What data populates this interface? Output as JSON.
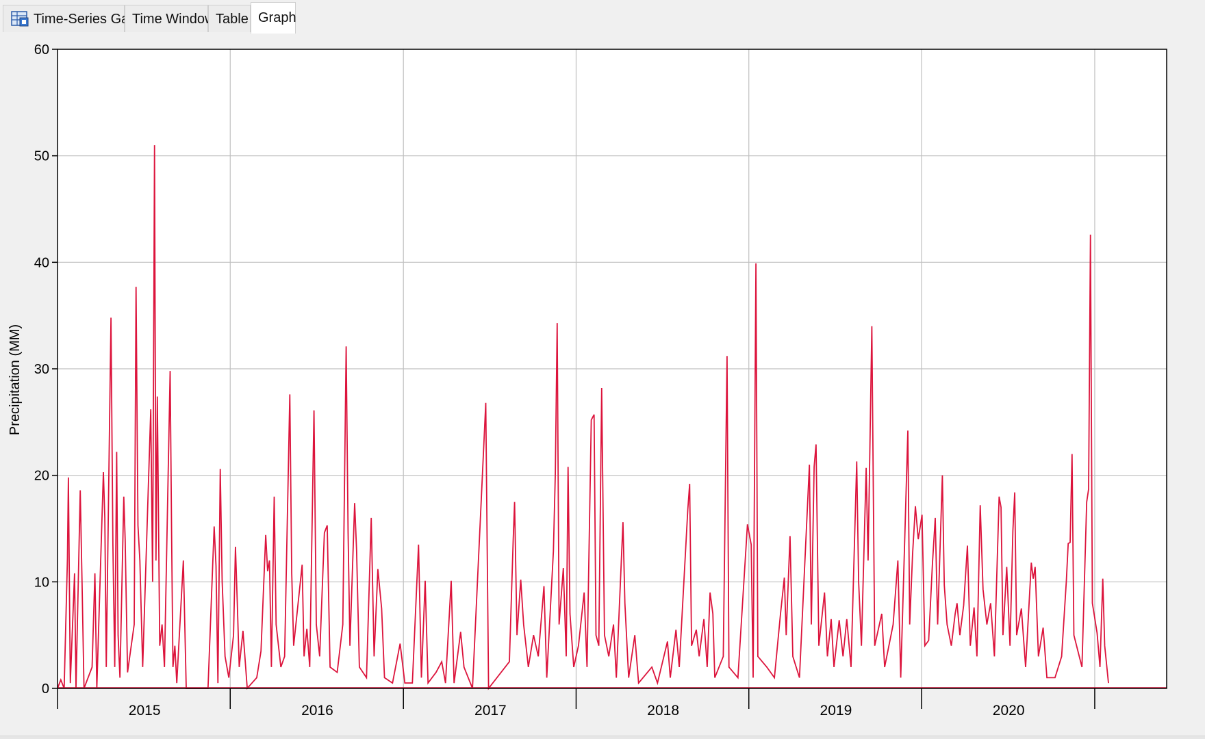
{
  "tabs": [
    {
      "label": "Time-Series Gage",
      "icon": "gage-table-icon",
      "active": false
    },
    {
      "label": "Time Window",
      "active": false
    },
    {
      "label": "Table",
      "active": false
    },
    {
      "label": "Graph",
      "active": true
    }
  ],
  "colors": {
    "series": "#dc143c",
    "grid": "#c0c0c0",
    "plot_bg": "#ffffff",
    "axis": "#000000"
  },
  "chart_data": {
    "type": "line",
    "ylabel": "Precipitation (MM)",
    "xlabel": "",
    "ylim": [
      0,
      60
    ],
    "yticks": [
      0,
      10,
      20,
      30,
      40,
      50,
      60
    ],
    "xlim": [
      "2014-07-01",
      "2020-11-30"
    ],
    "xticks": [
      "2014-07-01",
      "2015-07-01",
      "2016-07-01",
      "2017-07-01",
      "2018-07-01",
      "2019-07-01",
      "2020-07-01"
    ],
    "xtick_labels": [
      {
        "label": "2015",
        "at": "2015-01-01"
      },
      {
        "label": "2016",
        "at": "2016-01-01"
      },
      {
        "label": "2017",
        "at": "2017-01-01"
      },
      {
        "label": "2018",
        "at": "2018-01-01"
      },
      {
        "label": "2019",
        "at": "2019-01-01"
      },
      {
        "label": "2020",
        "at": "2020-01-01"
      }
    ],
    "grid": true,
    "series": [
      {
        "points": [
          [
            "2014-07-01",
            0
          ],
          [
            "2014-07-08",
            0.8
          ],
          [
            "2014-07-15",
            0
          ],
          [
            "2014-07-22",
            12.2
          ],
          [
            "2014-07-24",
            19.8
          ],
          [
            "2014-07-28",
            0.5
          ],
          [
            "2014-08-06",
            10.8
          ],
          [
            "2014-08-09",
            0
          ],
          [
            "2014-08-18",
            18.6
          ],
          [
            "2014-08-22",
            9.7
          ],
          [
            "2014-08-26",
            0
          ],
          [
            "2014-09-12",
            2
          ],
          [
            "2014-09-18",
            10.8
          ],
          [
            "2014-09-22",
            0
          ],
          [
            "2014-10-06",
            20.3
          ],
          [
            "2014-10-09",
            16
          ],
          [
            "2014-10-12",
            2
          ],
          [
            "2014-10-22",
            34.8
          ],
          [
            "2014-10-26",
            13.5
          ],
          [
            "2014-10-30",
            2
          ],
          [
            "2014-11-03",
            22.2
          ],
          [
            "2014-11-06",
            5
          ],
          [
            "2014-11-10",
            1
          ],
          [
            "2014-11-18",
            18
          ],
          [
            "2014-11-21",
            14
          ],
          [
            "2014-11-26",
            1.5
          ],
          [
            "2014-12-10",
            6
          ],
          [
            "2014-12-14",
            37.7
          ],
          [
            "2014-12-18",
            15.3
          ],
          [
            "2014-12-22",
            12
          ],
          [
            "2014-12-28",
            2
          ],
          [
            "2015-01-14",
            26.2
          ],
          [
            "2015-01-18",
            10
          ],
          [
            "2015-01-22",
            51
          ],
          [
            "2015-01-25",
            12
          ],
          [
            "2015-01-28",
            27.4
          ],
          [
            "2015-02-02",
            4
          ],
          [
            "2015-02-07",
            6
          ],
          [
            "2015-02-12",
            2
          ],
          [
            "2015-02-24",
            29.8
          ],
          [
            "2015-02-27",
            14.8
          ],
          [
            "2015-03-02",
            2
          ],
          [
            "2015-03-06",
            4
          ],
          [
            "2015-03-10",
            0.5
          ],
          [
            "2015-03-24",
            12
          ],
          [
            "2015-03-30",
            0
          ],
          [
            "2015-05-15",
            0
          ],
          [
            "2015-05-28",
            15.2
          ],
          [
            "2015-06-01",
            11.5
          ],
          [
            "2015-06-05",
            0.5
          ],
          [
            "2015-06-10",
            20.6
          ],
          [
            "2015-06-14",
            10
          ],
          [
            "2015-06-20",
            3
          ],
          [
            "2015-06-28",
            1
          ],
          [
            "2015-07-08",
            5
          ],
          [
            "2015-07-12",
            13.3
          ],
          [
            "2015-07-16",
            8
          ],
          [
            "2015-07-20",
            2
          ],
          [
            "2015-07-28",
            5.4
          ],
          [
            "2015-08-06",
            0
          ],
          [
            "2015-08-26",
            1
          ],
          [
            "2015-09-04",
            3.5
          ],
          [
            "2015-09-14",
            14.4
          ],
          [
            "2015-09-18",
            11
          ],
          [
            "2015-09-22",
            12
          ],
          [
            "2015-09-26",
            2
          ],
          [
            "2015-10-02",
            18
          ],
          [
            "2015-10-06",
            6
          ],
          [
            "2015-10-16",
            2
          ],
          [
            "2015-10-24",
            3
          ],
          [
            "2015-11-04",
            27.6
          ],
          [
            "2015-11-08",
            10.8
          ],
          [
            "2015-11-12",
            4
          ],
          [
            "2015-11-30",
            11.6
          ],
          [
            "2015-12-04",
            3
          ],
          [
            "2015-12-10",
            5.6
          ],
          [
            "2015-12-16",
            2
          ],
          [
            "2015-12-25",
            26.1
          ],
          [
            "2015-12-30",
            6
          ],
          [
            "2016-01-06",
            3
          ],
          [
            "2016-01-16",
            14.6
          ],
          [
            "2016-01-22",
            15.3
          ],
          [
            "2016-01-28",
            2
          ],
          [
            "2016-02-12",
            1.5
          ],
          [
            "2016-02-24",
            6
          ],
          [
            "2016-03-02",
            32.1
          ],
          [
            "2016-03-06",
            14.7
          ],
          [
            "2016-03-10",
            4
          ],
          [
            "2016-03-20",
            17.4
          ],
          [
            "2016-03-24",
            13
          ],
          [
            "2016-03-30",
            2
          ],
          [
            "2016-04-14",
            1
          ],
          [
            "2016-04-24",
            16
          ],
          [
            "2016-04-30",
            3
          ],
          [
            "2016-05-08",
            11.2
          ],
          [
            "2016-05-16",
            7.5
          ],
          [
            "2016-05-22",
            1
          ],
          [
            "2016-06-08",
            0.5
          ],
          [
            "2016-06-24",
            4.2
          ],
          [
            "2016-07-04",
            0.5
          ],
          [
            "2016-07-20",
            0.5
          ],
          [
            "2016-08-02",
            13.5
          ],
          [
            "2016-08-08",
            1
          ],
          [
            "2016-08-16",
            10.1
          ],
          [
            "2016-08-22",
            0.5
          ],
          [
            "2016-09-08",
            1.5
          ],
          [
            "2016-09-20",
            2.5
          ],
          [
            "2016-09-28",
            0.5
          ],
          [
            "2016-10-10",
            10.1
          ],
          [
            "2016-10-16",
            0.5
          ],
          [
            "2016-10-30",
            5.3
          ],
          [
            "2016-11-06",
            2
          ],
          [
            "2016-11-24",
            0
          ],
          [
            "2016-12-22",
            26.8
          ],
          [
            "2016-12-28",
            0
          ],
          [
            "2017-02-10",
            2.5
          ],
          [
            "2017-02-18",
            14
          ],
          [
            "2017-02-21",
            17.5
          ],
          [
            "2017-02-26",
            5
          ],
          [
            "2017-03-06",
            10.2
          ],
          [
            "2017-03-12",
            6
          ],
          [
            "2017-03-22",
            2
          ],
          [
            "2017-04-02",
            5
          ],
          [
            "2017-04-12",
            3
          ],
          [
            "2017-04-24",
            9.6
          ],
          [
            "2017-04-30",
            1
          ],
          [
            "2017-05-14",
            12.9
          ],
          [
            "2017-05-18",
            20.2
          ],
          [
            "2017-05-22",
            34.3
          ],
          [
            "2017-05-26",
            6
          ],
          [
            "2017-06-04",
            11.3
          ],
          [
            "2017-06-10",
            3
          ],
          [
            "2017-06-14",
            20.8
          ],
          [
            "2017-06-18",
            7
          ],
          [
            "2017-06-26",
            2
          ],
          [
            "2017-07-06",
            4
          ],
          [
            "2017-07-18",
            9
          ],
          [
            "2017-07-24",
            2
          ],
          [
            "2017-08-02",
            25.2
          ],
          [
            "2017-08-08",
            25.7
          ],
          [
            "2017-08-12",
            5
          ],
          [
            "2017-08-18",
            4
          ],
          [
            "2017-08-24",
            28.2
          ],
          [
            "2017-08-30",
            5
          ],
          [
            "2017-09-08",
            3
          ],
          [
            "2017-09-18",
            6
          ],
          [
            "2017-09-24",
            1
          ],
          [
            "2017-10-08",
            15.6
          ],
          [
            "2017-10-12",
            8
          ],
          [
            "2017-10-20",
            1
          ],
          [
            "2017-11-02",
            5
          ],
          [
            "2017-11-10",
            0.5
          ],
          [
            "2017-12-08",
            2
          ],
          [
            "2017-12-20",
            0.5
          ],
          [
            "2018-01-10",
            4.4
          ],
          [
            "2018-01-16",
            1
          ],
          [
            "2018-01-28",
            5.5
          ],
          [
            "2018-02-04",
            2
          ],
          [
            "2018-02-22",
            16.8
          ],
          [
            "2018-02-26",
            19.2
          ],
          [
            "2018-03-02",
            4
          ],
          [
            "2018-03-12",
            5.5
          ],
          [
            "2018-03-18",
            3
          ],
          [
            "2018-03-28",
            6.5
          ],
          [
            "2018-04-04",
            2
          ],
          [
            "2018-04-10",
            9
          ],
          [
            "2018-04-16",
            7
          ],
          [
            "2018-04-20",
            1
          ],
          [
            "2018-05-08",
            3
          ],
          [
            "2018-05-16",
            31.2
          ],
          [
            "2018-05-20",
            2
          ],
          [
            "2018-06-08",
            1
          ],
          [
            "2018-06-28",
            15.4
          ],
          [
            "2018-07-06",
            13.5
          ],
          [
            "2018-07-10",
            1
          ],
          [
            "2018-07-16",
            39.9
          ],
          [
            "2018-07-20",
            3
          ],
          [
            "2018-08-08",
            2
          ],
          [
            "2018-08-24",
            1
          ],
          [
            "2018-09-06",
            7
          ],
          [
            "2018-09-14",
            10.4
          ],
          [
            "2018-09-18",
            5
          ],
          [
            "2018-09-26",
            14.3
          ],
          [
            "2018-10-02",
            3
          ],
          [
            "2018-10-16",
            1
          ],
          [
            "2018-11-06",
            21
          ],
          [
            "2018-11-10",
            6
          ],
          [
            "2018-11-16",
            20.8
          ],
          [
            "2018-11-20",
            22.9
          ],
          [
            "2018-11-26",
            4
          ],
          [
            "2018-12-08",
            9
          ],
          [
            "2018-12-14",
            3
          ],
          [
            "2018-12-22",
            6.5
          ],
          [
            "2018-12-28",
            2
          ],
          [
            "2019-01-08",
            6.4
          ],
          [
            "2019-01-16",
            3
          ],
          [
            "2019-01-24",
            6.5
          ],
          [
            "2019-02-02",
            2
          ],
          [
            "2019-02-14",
            21.3
          ],
          [
            "2019-02-18",
            10
          ],
          [
            "2019-02-24",
            4
          ],
          [
            "2019-03-06",
            20.7
          ],
          [
            "2019-03-10",
            12
          ],
          [
            "2019-03-18",
            34
          ],
          [
            "2019-03-24",
            4
          ],
          [
            "2019-04-08",
            7
          ],
          [
            "2019-04-14",
            2
          ],
          [
            "2019-05-02",
            6
          ],
          [
            "2019-05-12",
            12
          ],
          [
            "2019-05-18",
            1
          ],
          [
            "2019-06-02",
            24.2
          ],
          [
            "2019-06-06",
            6
          ],
          [
            "2019-06-12",
            12.6
          ],
          [
            "2019-06-18",
            17.1
          ],
          [
            "2019-06-24",
            14
          ],
          [
            "2019-07-02",
            16.3
          ],
          [
            "2019-07-08",
            4
          ],
          [
            "2019-07-16",
            4.5
          ],
          [
            "2019-07-24",
            11.7
          ],
          [
            "2019-07-30",
            16
          ],
          [
            "2019-08-04",
            6
          ],
          [
            "2019-08-14",
            20
          ],
          [
            "2019-08-18",
            9.7
          ],
          [
            "2019-08-24",
            6
          ],
          [
            "2019-09-02",
            4
          ],
          [
            "2019-09-10",
            7
          ],
          [
            "2019-09-14",
            8
          ],
          [
            "2019-09-20",
            5
          ],
          [
            "2019-09-28",
            7.8
          ],
          [
            "2019-10-06",
            13.4
          ],
          [
            "2019-10-12",
            4
          ],
          [
            "2019-10-20",
            7.6
          ],
          [
            "2019-10-26",
            3
          ],
          [
            "2019-11-02",
            17.2
          ],
          [
            "2019-11-08",
            9.3
          ],
          [
            "2019-11-16",
            6
          ],
          [
            "2019-11-24",
            8
          ],
          [
            "2019-12-02",
            3
          ],
          [
            "2019-12-12",
            18
          ],
          [
            "2019-12-16",
            17
          ],
          [
            "2019-12-20",
            5
          ],
          [
            "2019-12-28",
            11.4
          ],
          [
            "2020-01-04",
            4
          ],
          [
            "2020-01-10",
            14.8
          ],
          [
            "2020-01-14",
            18.4
          ],
          [
            "2020-01-18",
            5
          ],
          [
            "2020-01-28",
            7.5
          ],
          [
            "2020-02-06",
            2
          ],
          [
            "2020-02-18",
            11.8
          ],
          [
            "2020-02-22",
            10.3
          ],
          [
            "2020-02-26",
            11.4
          ],
          [
            "2020-03-04",
            3
          ],
          [
            "2020-03-14",
            5.7
          ],
          [
            "2020-03-22",
            1
          ],
          [
            "2020-04-08",
            1
          ],
          [
            "2020-04-22",
            3
          ],
          [
            "2020-05-02",
            10.1
          ],
          [
            "2020-05-06",
            13.6
          ],
          [
            "2020-05-10",
            13.7
          ],
          [
            "2020-05-14",
            22
          ],
          [
            "2020-05-18",
            5
          ],
          [
            "2020-06-04",
            2
          ],
          [
            "2020-06-14",
            17.5
          ],
          [
            "2020-06-18",
            18.7
          ],
          [
            "2020-06-22",
            42.6
          ],
          [
            "2020-06-26",
            8
          ],
          [
            "2020-07-06",
            5.2
          ],
          [
            "2020-07-12",
            2
          ],
          [
            "2020-07-18",
            10.3
          ],
          [
            "2020-07-22",
            4
          ],
          [
            "2020-07-30",
            0.5
          ]
        ]
      }
    ]
  }
}
